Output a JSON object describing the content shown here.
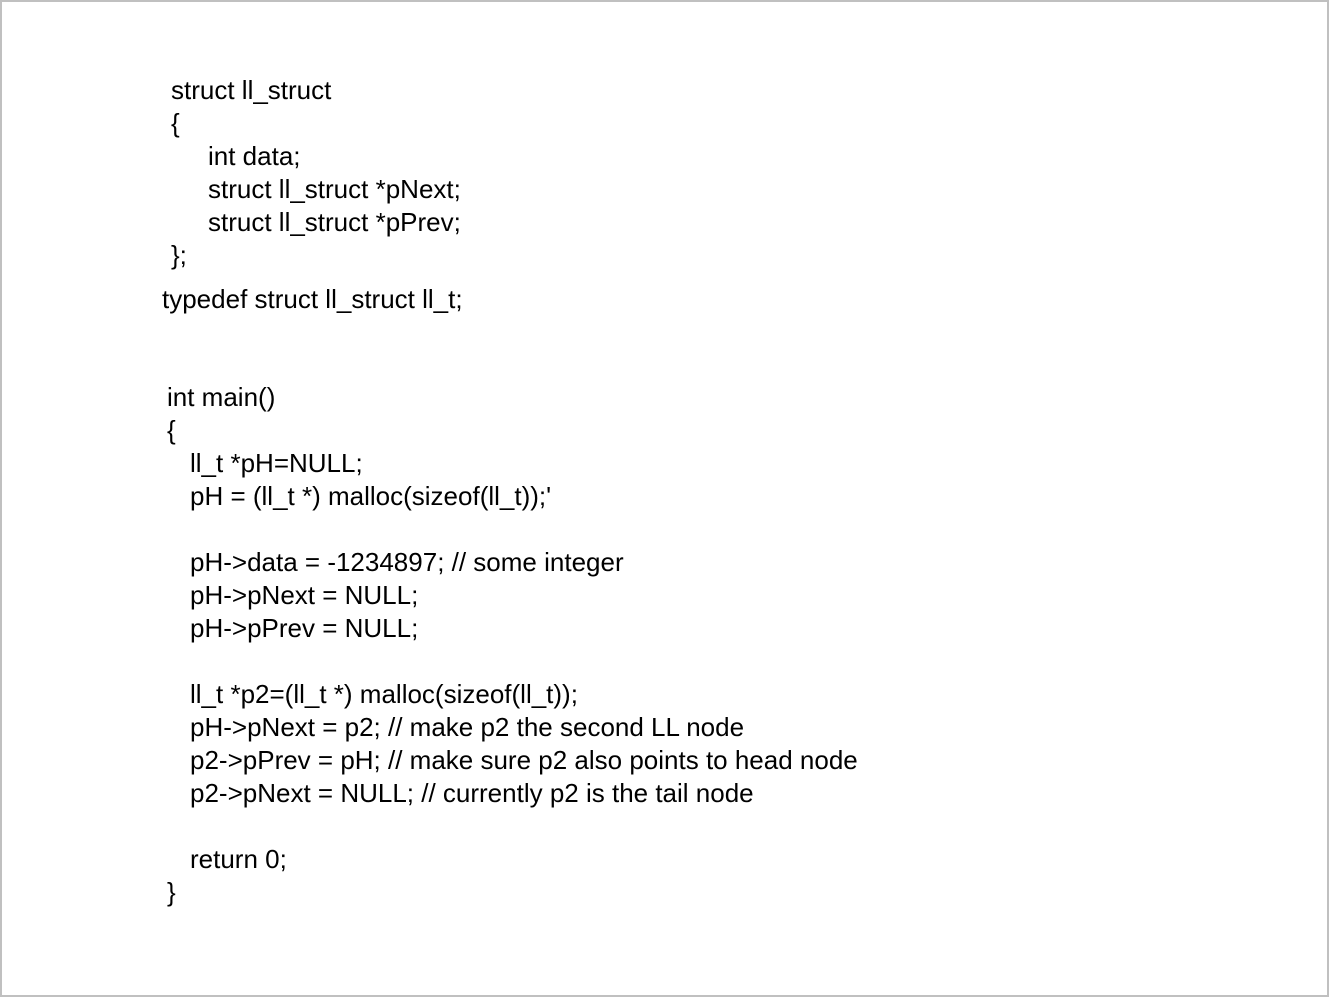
{
  "document": {
    "struct_block": [
      "struct ll_struct",
      "{",
      "int data;",
      "struct ll_struct *pNext;",
      "struct ll_struct *pPrev;",
      "};"
    ],
    "typedef_line": "typedef struct ll_struct ll_t;",
    "main_block": [
      "int main()",
      "{",
      "ll_t *pH=NULL;",
      "pH = (ll_t *) malloc(sizeof(ll_t));'",
      "",
      "pH->data = -1234897; // some integer",
      "pH->pNext = NULL;",
      "pH->pPrev = NULL;",
      "",
      "ll_t *p2=(ll_t *) malloc(sizeof(ll_t));",
      "pH->pNext = p2; // make p2 the second LL node",
      "p2->pPrev = pH; // make sure p2 also points to head node",
      "p2->pNext = NULL; // currently p2 is the tail node",
      "",
      "return 0;",
      "}"
    ]
  }
}
